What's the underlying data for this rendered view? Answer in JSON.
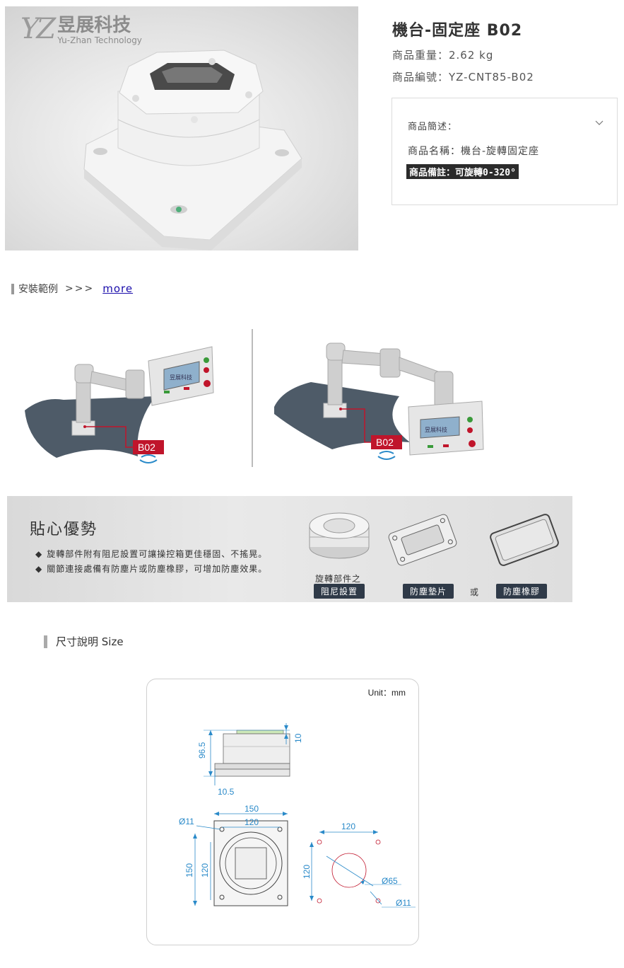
{
  "product": {
    "title": "機台-固定座 B02",
    "weight": "商品重量：2.62 kg",
    "code": "商品編號：YZ-CNT85-B02"
  },
  "logo": {
    "mark": "YZ",
    "cn": "昱展科技",
    "en": "Yu-Zhan Technology"
  },
  "description": {
    "heading": "商品簡述：",
    "name": "商品名稱：機台-旋轉固定座",
    "note": "商品備註：可旋轉0-320°"
  },
  "install": {
    "heading": "安裝範例",
    "arrows": ">>>",
    "more_link": "more",
    "label_left": "B02",
    "label_right": "B02",
    "screen_text": "昱展科技"
  },
  "advantage": {
    "title": "貼心優勢",
    "points": [
      "旋轉部件附有阻尼設置可讓操控箱更佳穩固、不搖晃。",
      "關節連接處備有防塵片或防塵橡膠，可增加防塵效果。"
    ],
    "caption_top": "旋轉部件之",
    "tag_damping": "阻尼設置",
    "tag_plate": "防塵墊片",
    "or": "或",
    "tag_rubber": "防塵橡膠"
  },
  "size": {
    "heading": "尺寸說明 Size",
    "unit": "Unit：mm",
    "dims": {
      "top_gap": "10",
      "height": "96.5",
      "base": "10.5",
      "outer_w": "150",
      "inner_w": "120",
      "diameter_small": "Ø11",
      "outer_h": "150",
      "inner_h": "120",
      "hole_w": "120",
      "hole_h": "120",
      "center_d": "Ø65",
      "hole_d": "Ø11"
    }
  },
  "colors": {
    "accent_red": "#c0152b",
    "dim_blue": "#2a8ac9",
    "tag_bg": "#2f3a48"
  }
}
